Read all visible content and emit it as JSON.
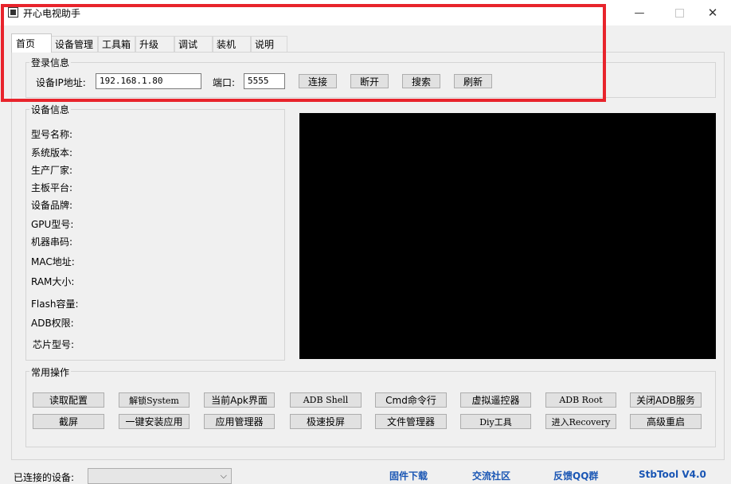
{
  "window": {
    "title": "开心电视助手"
  },
  "tabs": [
    "首页",
    "设备管理",
    "工具箱",
    "升级",
    "调试",
    "装机",
    "说明"
  ],
  "login": {
    "legend": "登录信息",
    "ip_label": "设备IP地址:",
    "ip_value": "192.168.1.80",
    "port_label": "端口:",
    "port_value": "5555",
    "buttons": [
      "连接",
      "断开",
      "搜索",
      "刷新"
    ]
  },
  "device_info": {
    "legend": "设备信息",
    "fields": [
      "型号名称:",
      "系统版本:",
      "生产厂家:",
      "主板平台:",
      "设备品牌:",
      "GPU型号:",
      "机器串码:",
      "MAC地址:",
      "RAM大小:",
      "Flash容量:",
      "ADB权限:",
      "芯片型号:"
    ]
  },
  "common_ops": {
    "legend": "常用操作",
    "row1": [
      "读取配置",
      "解锁System",
      "当前Apk界面",
      "ADB Shell",
      "Cmd命令行",
      "虚拟遥控器",
      "ADB  Root",
      "关闭ADB服务"
    ],
    "row2": [
      "截屏",
      "一键安装应用",
      "应用管理器",
      "极速投屏",
      "文件管理器",
      "Diy工具",
      "进入Recovery",
      "高级重启"
    ]
  },
  "status_bar": {
    "connected_label": "已连接的设备:",
    "combo_value": "",
    "links": [
      "固件下载",
      "交流社区",
      "反馈QQ群",
      "StbTool V4.0"
    ]
  },
  "colors": {
    "annotation": "#e8242c",
    "link": "#1a56b4",
    "screen": "#000000"
  }
}
